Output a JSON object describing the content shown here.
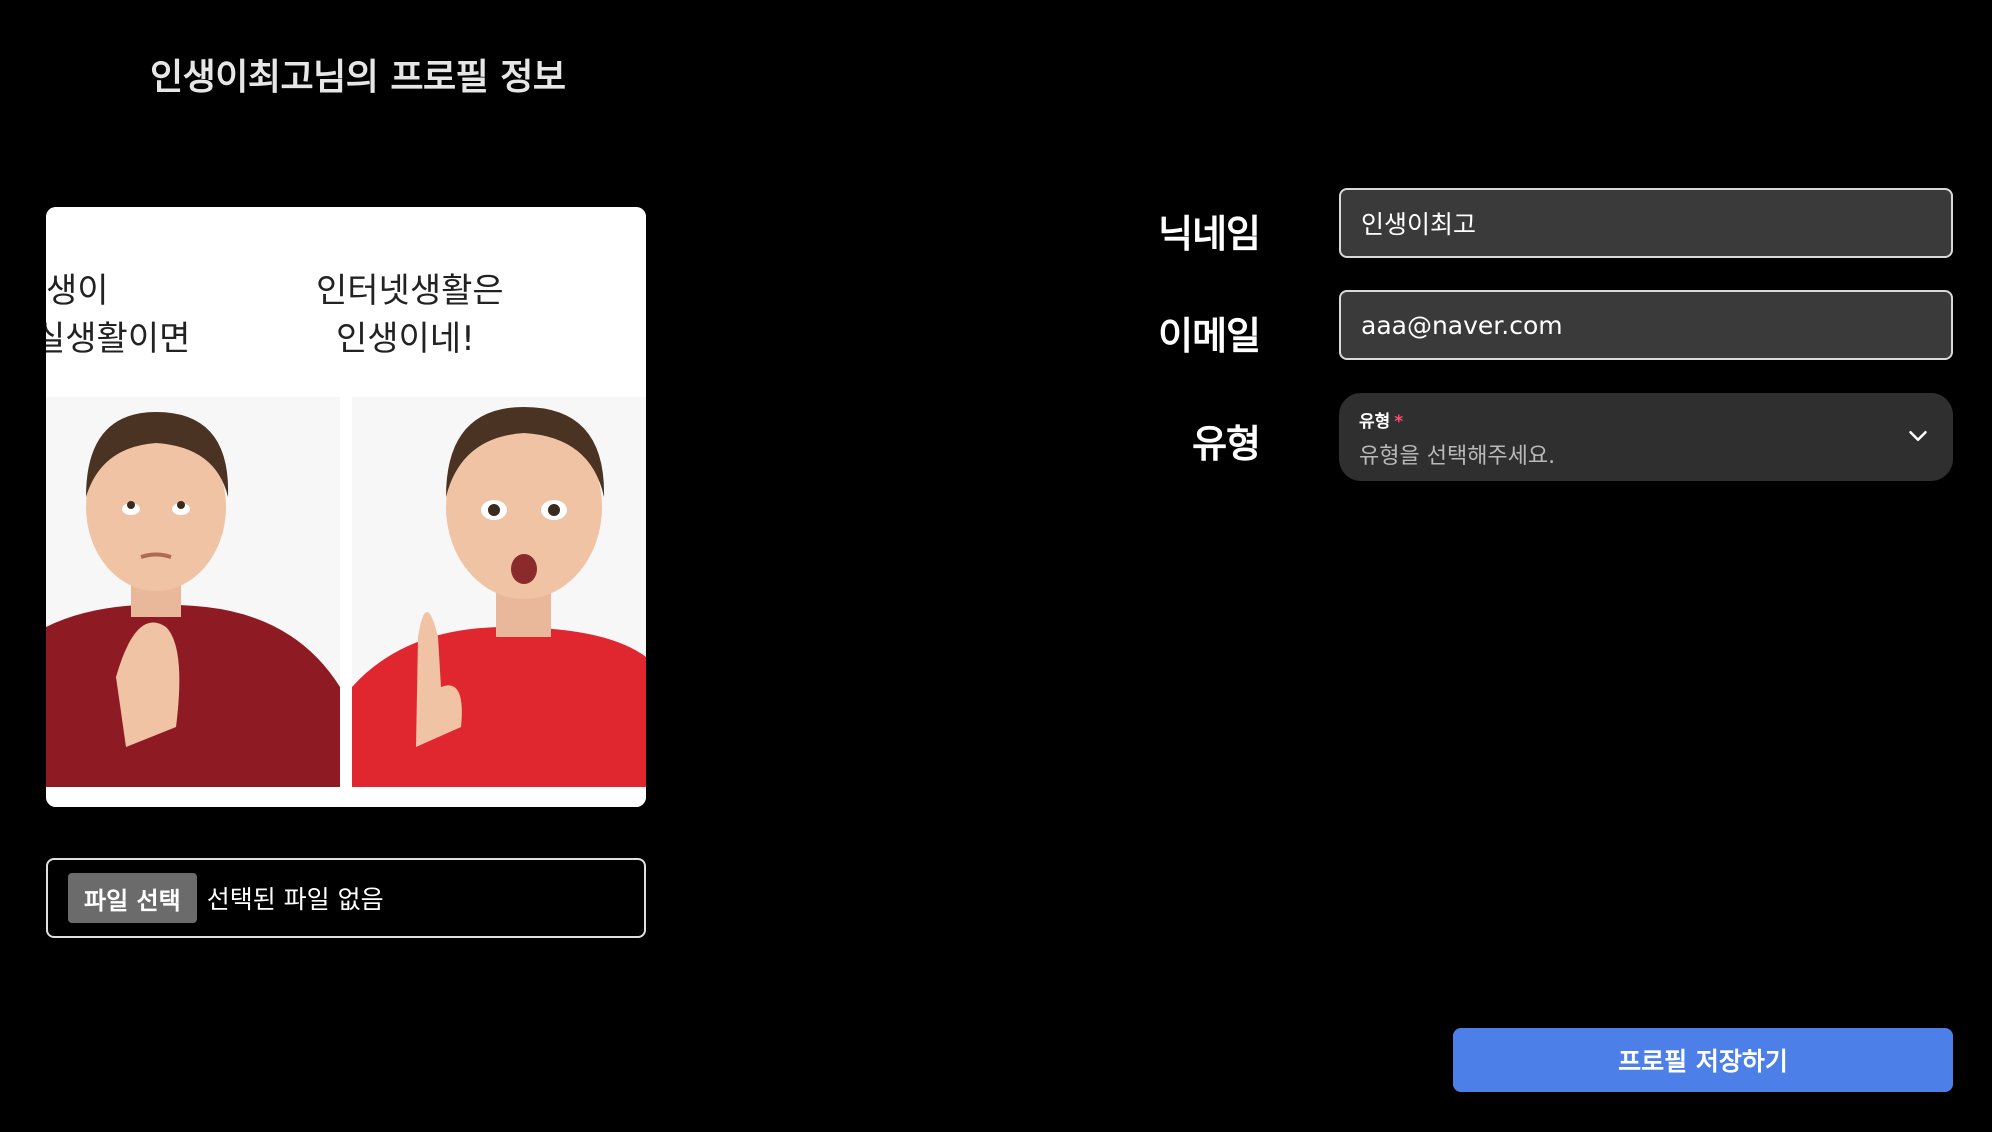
{
  "page": {
    "title": "인생이최고님의 프로필 정보"
  },
  "photo": {
    "caption_left_line1": "생이",
    "caption_left_line2": "실생활이면",
    "caption_right_line1": "인터넷생활은",
    "caption_right_line2": "인생이네!"
  },
  "file_input": {
    "button_label": "파일 선택",
    "status": "선택된 파일 없음"
  },
  "form": {
    "nickname": {
      "label": "닉네임",
      "value": "인생이최고"
    },
    "email": {
      "label": "이메일",
      "value": "aaa@naver.com"
    },
    "type": {
      "label": "유형",
      "inner_label": "유형",
      "required_mark": "*",
      "placeholder": "유형을 선택해주세요.",
      "icon": "chevron-down-icon"
    }
  },
  "actions": {
    "save_label": "프로필 저장하기"
  },
  "colors": {
    "accent": "#4d7fe9",
    "required": "#ff4d6d",
    "input_bg": "#3a3a3a"
  }
}
